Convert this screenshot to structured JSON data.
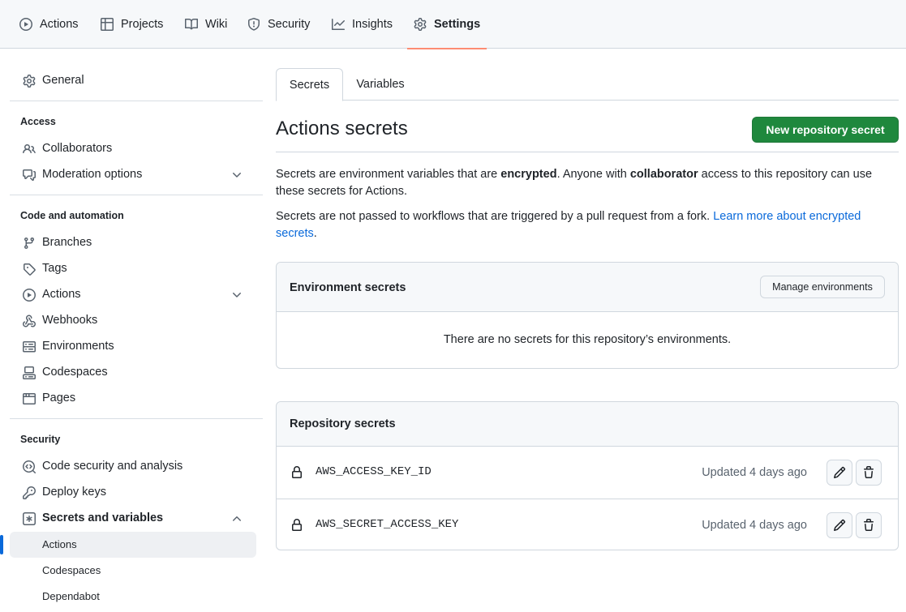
{
  "topnav": {
    "items": [
      {
        "label": "Actions",
        "icon": "play-icon"
      },
      {
        "label": "Projects",
        "icon": "table-icon"
      },
      {
        "label": "Wiki",
        "icon": "book-icon"
      },
      {
        "label": "Security",
        "icon": "shield-icon"
      },
      {
        "label": "Insights",
        "icon": "graph-icon"
      },
      {
        "label": "Settings",
        "icon": "gear-icon",
        "active": true
      }
    ]
  },
  "sidebar": {
    "general": "General",
    "sections": {
      "access": "Access",
      "code": "Code and automation",
      "security": "Security"
    },
    "access_items": [
      {
        "label": "Collaborators",
        "icon": "people-icon"
      },
      {
        "label": "Moderation options",
        "icon": "comment-discussion-icon",
        "expandable": true
      }
    ],
    "code_items": [
      {
        "label": "Branches",
        "icon": "git-branch-icon"
      },
      {
        "label": "Tags",
        "icon": "tag-icon"
      },
      {
        "label": "Actions",
        "icon": "play-icon",
        "expandable": true
      },
      {
        "label": "Webhooks",
        "icon": "webhook-icon"
      },
      {
        "label": "Environments",
        "icon": "server-icon"
      },
      {
        "label": "Codespaces",
        "icon": "codespaces-icon"
      },
      {
        "label": "Pages",
        "icon": "browser-icon"
      }
    ],
    "security_items": [
      {
        "label": "Code security and analysis",
        "icon": "codescan-icon"
      },
      {
        "label": "Deploy keys",
        "icon": "key-icon"
      },
      {
        "label": "Secrets and variables",
        "icon": "key-asterisk-icon",
        "expanded": true
      }
    ],
    "secrets_sub": [
      {
        "label": "Actions",
        "selected": true
      },
      {
        "label": "Codespaces"
      },
      {
        "label": "Dependabot"
      }
    ]
  },
  "tabs": {
    "secrets": "Secrets",
    "variables": "Variables",
    "active": "Secrets"
  },
  "main": {
    "title": "Actions secrets",
    "new_button": "New repository secret",
    "para1_a": "Secrets are environment variables that are ",
    "para1_b": "encrypted",
    "para1_c": ". Anyone with ",
    "para1_d": "collaborator",
    "para1_e": " access to this repository can use these secrets for Actions.",
    "para2_a": "Secrets are not passed to workflows that are triggered by a pull request from a fork. ",
    "para2_link": "Learn more about encrypted secrets",
    "para2_end": "."
  },
  "env_box": {
    "title": "Environment secrets",
    "manage_button": "Manage environments",
    "empty_text": "There are no secrets for this repository’s environments."
  },
  "repo_box": {
    "title": "Repository secrets",
    "secrets": [
      {
        "name": "AWS_ACCESS_KEY_ID",
        "updated": "Updated 4 days ago"
      },
      {
        "name": "AWS_SECRET_ACCESS_KEY",
        "updated": "Updated 4 days ago"
      }
    ]
  },
  "colors": {
    "primary_button": "#1f883d",
    "link": "#0969da",
    "active_underline": "#fd8c73",
    "selected_indicator": "#0969da"
  }
}
